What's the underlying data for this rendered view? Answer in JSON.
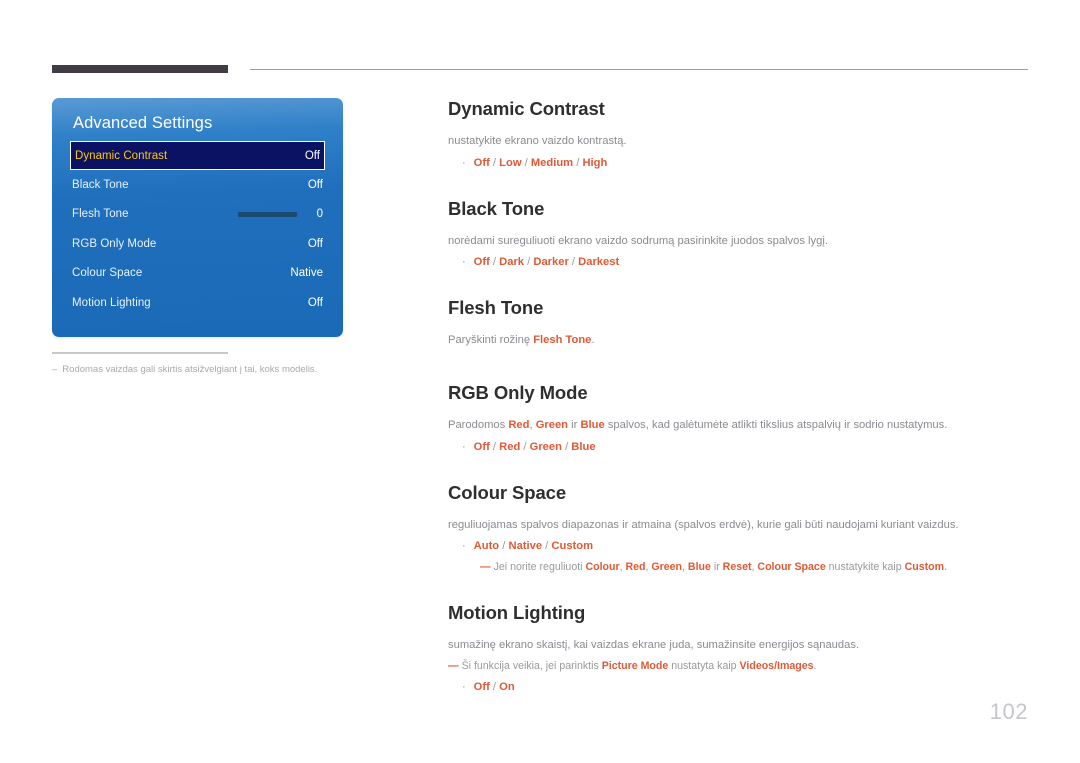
{
  "page": {
    "number": "102"
  },
  "osd": {
    "title": "Advanced Settings",
    "rows": [
      {
        "label": "Dynamic Contrast",
        "value": "Off",
        "selected": true,
        "slider": false
      },
      {
        "label": "Black Tone",
        "value": "Off",
        "selected": false,
        "slider": false
      },
      {
        "label": "Flesh Tone",
        "value": "0",
        "selected": false,
        "slider": true,
        "slider_percent": 51
      },
      {
        "label": "RGB Only Mode",
        "value": "Off",
        "selected": false,
        "slider": false
      },
      {
        "label": "Colour Space",
        "value": "Native",
        "selected": false,
        "slider": false
      },
      {
        "label": "Motion Lighting",
        "value": "Off",
        "selected": false,
        "slider": false
      }
    ],
    "note_dash": "–",
    "note": "Rodomas vaizdas gali skirtis atsižvelgiant į tai, koks modelis."
  },
  "sections": {
    "dynamic_contrast": {
      "heading": "Dynamic Contrast",
      "body": "nustatykite ekrano vaizdo kontrastą.",
      "bullet_dot": "·",
      "options": [
        "Off",
        "Low",
        "Medium",
        "High"
      ]
    },
    "black_tone": {
      "heading": "Black Tone",
      "body": "norėdami sureguliuoti ekrano vaizdo sodrumą pasirinkite juodos spalvos lygį.",
      "bullet_dot": "·",
      "options": [
        "Off",
        "Dark",
        "Darker",
        "Darkest"
      ]
    },
    "flesh_tone": {
      "heading": "Flesh Tone",
      "body_pre": "Paryškinti rožinę ",
      "body_em": "Flesh Tone",
      "body_post": "."
    },
    "rgb_only_mode": {
      "heading": "RGB Only Mode",
      "body_pre": "Parodomos ",
      "body_em1": "Red",
      "body_mid1": ", ",
      "body_em2": "Green",
      "body_mid2": " ir ",
      "body_em3": "Blue",
      "body_post": " spalvos, kad galėtumėte atlikti tikslius atspalvių ir sodrio nustatymus.",
      "bullet_dot": "·",
      "options": [
        "Off",
        "Red",
        "Green",
        "Blue"
      ]
    },
    "colour_space": {
      "heading": "Colour Space",
      "body": "reguliuojamas spalvos diapazonas ir atmaina (spalvos erdvė), kurie gali būti naudojami kuriant vaizdus.",
      "bullet_dot": "·",
      "options": [
        "Auto",
        "Native",
        "Custom"
      ],
      "note_dash": "—",
      "note_pre": "Jei norite reguliuoti ",
      "note_em1": "Colour",
      "note_mid1": ", ",
      "note_em2": "Red",
      "note_mid2": ", ",
      "note_em3": "Green",
      "note_mid3": ", ",
      "note_em4": "Blue",
      "note_mid4": " ir ",
      "note_em5": "Reset",
      "note_mid5": ", ",
      "note_em6": "Colour Space",
      "note_mid6": " nustatykite kaip ",
      "note_em7": "Custom",
      "note_post": "."
    },
    "motion_lighting": {
      "heading": "Motion Lighting",
      "body": "sumažinę ekrano skaistį, kai vaizdas ekrane juda, sumažinsite energijos sąnaudas.",
      "note_dash": "—",
      "note_pre": "Ši funkcija veikia, jei parinktis ",
      "note_em1": "Picture Mode",
      "note_mid1": " nustatyta kaip ",
      "note_em2": "Videos/Images",
      "note_post": ".",
      "bullet_dot": "·",
      "options": [
        "Off",
        "On"
      ]
    }
  },
  "colors": {
    "accent_orange": "#df5a35",
    "heading_dark": "#2f2f31",
    "body_gray": "#8b8a90",
    "osd_blue": "#1f6fbd",
    "osd_selected_bg": "#0b1263",
    "osd_selected_label": "#ffc800",
    "top_bar": "#403b47",
    "page_number": "#c6c5ce"
  }
}
